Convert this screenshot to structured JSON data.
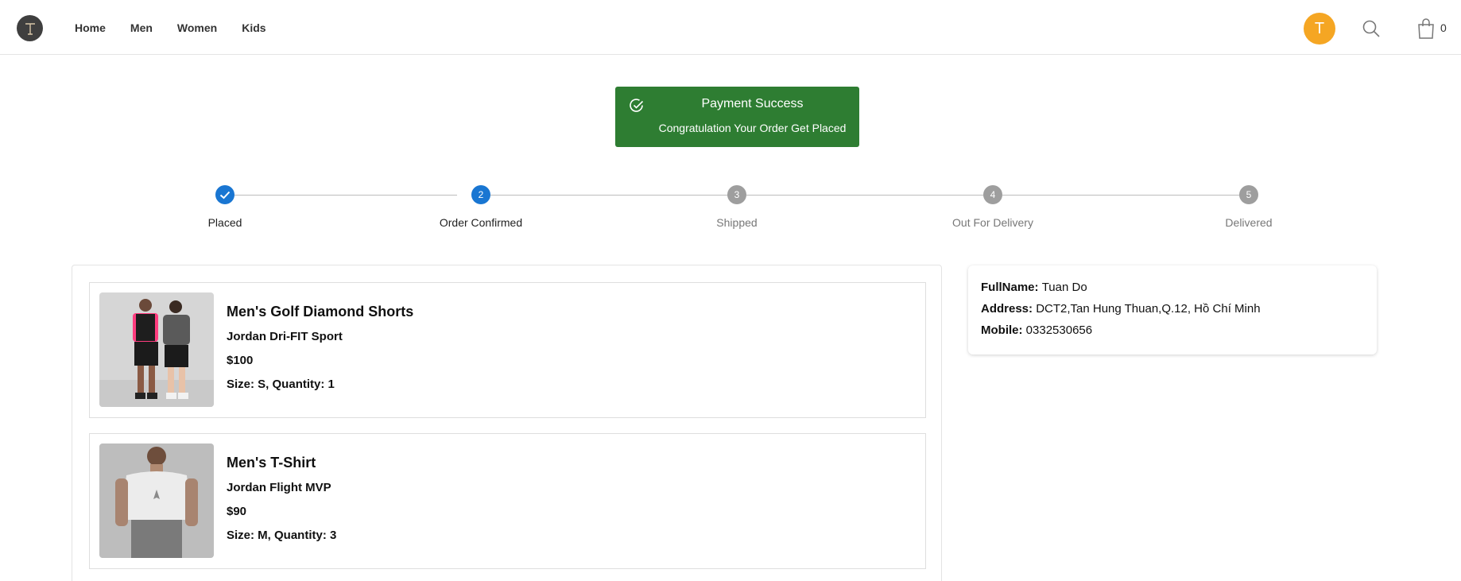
{
  "header": {
    "nav": [
      "Home",
      "Men",
      "Women",
      "Kids"
    ],
    "avatar_letter": "T",
    "cart_count": "0",
    "icons": {
      "search": "search-icon",
      "cart": "shopping-bag-icon"
    }
  },
  "banner": {
    "title": "Payment Success",
    "subtitle": "Congratulation Your Order Get Placed",
    "color": "#2e7d32"
  },
  "stepper": {
    "steps": [
      {
        "label": "Placed",
        "number": "1",
        "state": "done"
      },
      {
        "label": "Order Confirmed",
        "number": "2",
        "state": "active"
      },
      {
        "label": "Shipped",
        "number": "3",
        "state": "pending"
      },
      {
        "label": "Out For Delivery",
        "number": "4",
        "state": "pending"
      },
      {
        "label": "Delivered",
        "number": "5",
        "state": "pending"
      }
    ],
    "active_color": "#1976d2",
    "pending_color": "#9e9e9e"
  },
  "products": [
    {
      "name": "Men's Golf Diamond Shorts",
      "brand": "Jordan Dri-FIT Sport",
      "price": "$100",
      "size_qty": "Size: S, Quantity: 1"
    },
    {
      "name": "Men's T-Shirt",
      "brand": "Jordan Flight MVP",
      "price": "$90",
      "size_qty": "Size: M, Quantity: 3"
    }
  ],
  "address": {
    "fullname_label": "FullName:",
    "fullname": "Tuan Do",
    "address_label": "Address:",
    "address": "DCT2,Tan Hung Thuan,Q.12, Hồ Chí Minh",
    "mobile_label": "Mobile:",
    "mobile": "0332530656"
  }
}
